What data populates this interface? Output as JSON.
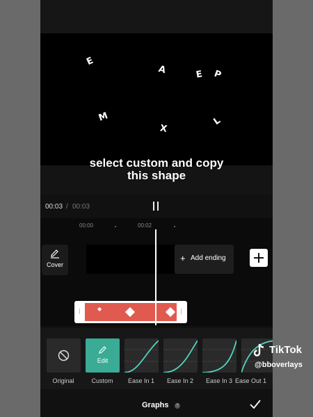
{
  "preview": {
    "letters": [
      "E",
      "A",
      "E",
      "P",
      "M",
      "X",
      "L"
    ],
    "caption_line1": "select custom and copy",
    "caption_line2": "this shape"
  },
  "player": {
    "current_time": "00:03",
    "separator": "/",
    "total_time": "00:03"
  },
  "timeline": {
    "ruler_labels": [
      "00:00",
      "00:02"
    ],
    "cover_label": "Cover",
    "add_ending_label": "Add ending"
  },
  "presets": [
    {
      "label": "Original"
    },
    {
      "label": "Custom",
      "inner_label": "Edit"
    },
    {
      "label": "Ease In 1"
    },
    {
      "label": "Ease In 2"
    },
    {
      "label": "Ease In 3"
    },
    {
      "label": "Ease Out 1"
    }
  ],
  "bottom": {
    "title": "Graphs",
    "help": "?"
  },
  "watermark": {
    "brand": "TikTok",
    "user": "@bboverlays"
  },
  "colors": {
    "accent": "#3aab94",
    "track": "#e05a4f",
    "curve": "#4fd6c0"
  }
}
